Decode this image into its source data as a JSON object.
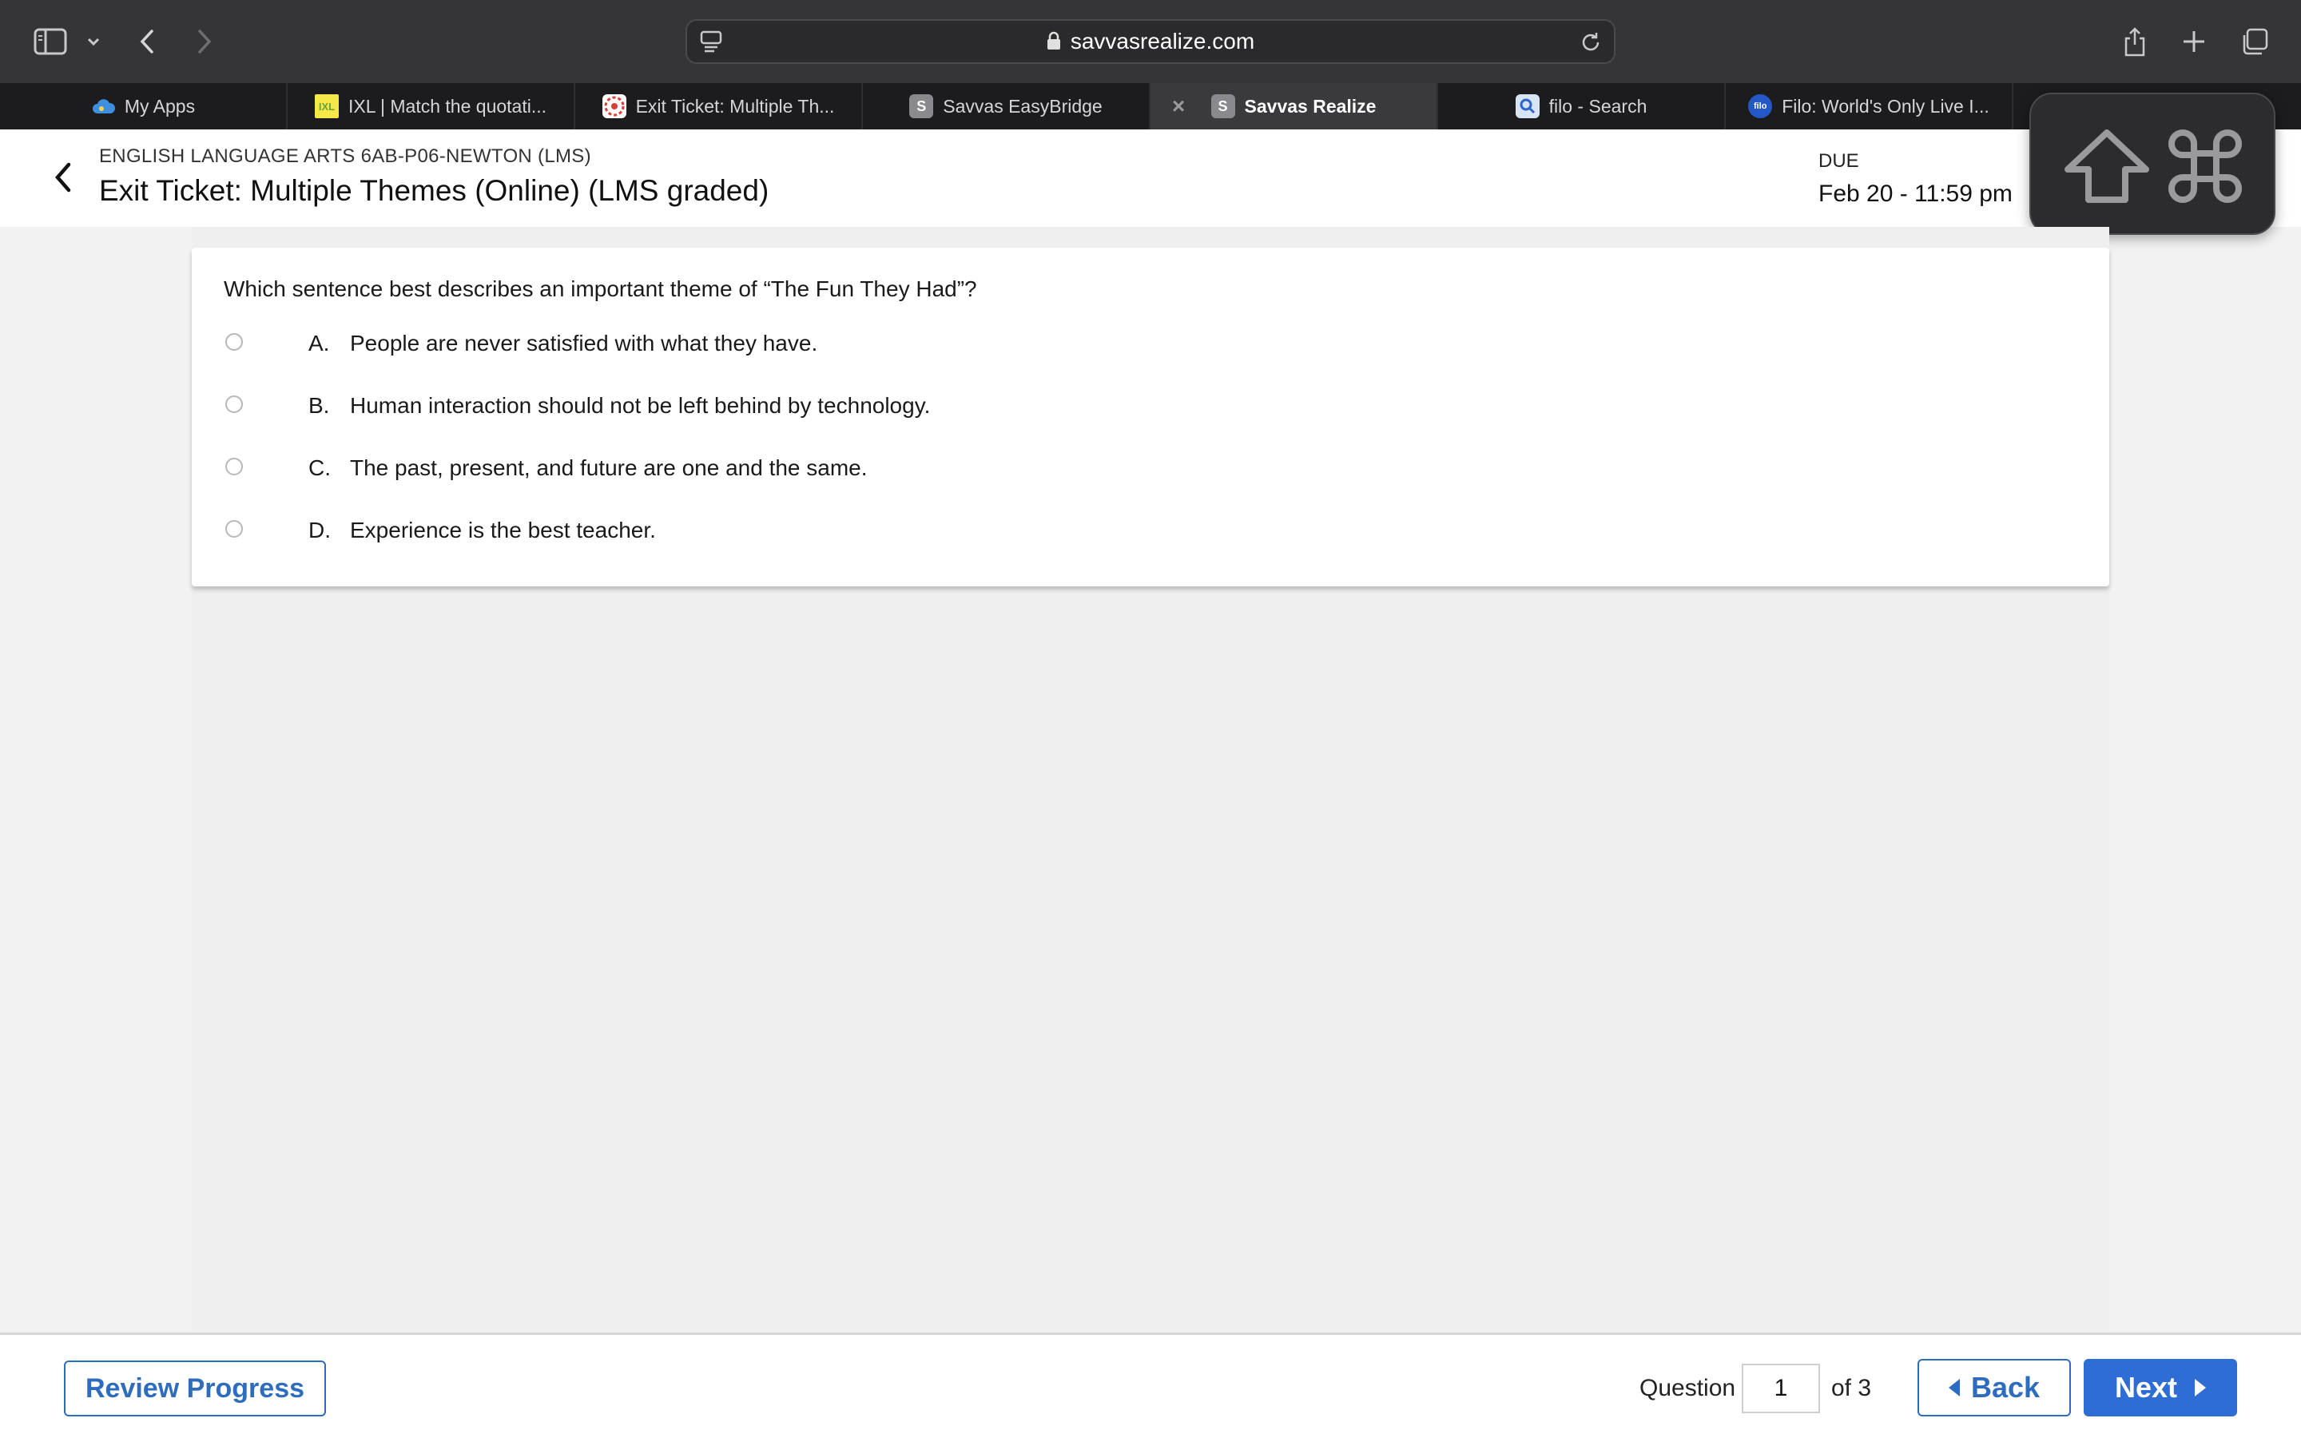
{
  "browser": {
    "url": "savvasrealize.com",
    "tabs": [
      {
        "label": "My Apps",
        "icon": "cloud-icon"
      },
      {
        "label": "IXL | Match the quotati...",
        "icon": "ixl-icon"
      },
      {
        "label": "Exit Ticket: Multiple Th...",
        "icon": "canvas-icon"
      },
      {
        "label": "Savvas EasyBridge",
        "icon": "savvas-icon"
      },
      {
        "label": "Savvas Realize",
        "icon": "savvas-icon",
        "active": true
      },
      {
        "label": "filo - Search",
        "icon": "search-icon"
      },
      {
        "label": "Filo: World's Only Live I...",
        "icon": "filo-icon"
      }
    ],
    "favicon_letters": {
      "savvas": "S",
      "filo": "filo",
      "ixl": "IXL"
    }
  },
  "header": {
    "course": "ENGLISH LANGUAGE ARTS 6AB-P06-NEWTON (LMS)",
    "title": "Exit Ticket: Multiple Themes (Online) (LMS graded)",
    "due_label": "DUE",
    "due_date": "Feb 20 - 11:59 pm"
  },
  "question": {
    "text": "Which sentence best describes an important theme of “The Fun They Had”?",
    "options": [
      {
        "letter": "A.",
        "text": "People are never satisfied with what they have."
      },
      {
        "letter": "B.",
        "text": "Human interaction should not be left behind by technology."
      },
      {
        "letter": "C.",
        "text": "The past, present, and future are one and the same."
      },
      {
        "letter": "D.",
        "text": "Experience is the best teacher."
      }
    ]
  },
  "footer": {
    "review_label": "Review Progress",
    "question_label": "Question",
    "question_number": "1",
    "of_label": "of 3",
    "back_label": "Back",
    "next_label": "Next"
  },
  "colors": {
    "accent_blue": "#2e6dbd",
    "next_blue": "#2e6dd3",
    "toolbar_bg": "#353537",
    "tabbar_bg": "#1c1c1e"
  }
}
